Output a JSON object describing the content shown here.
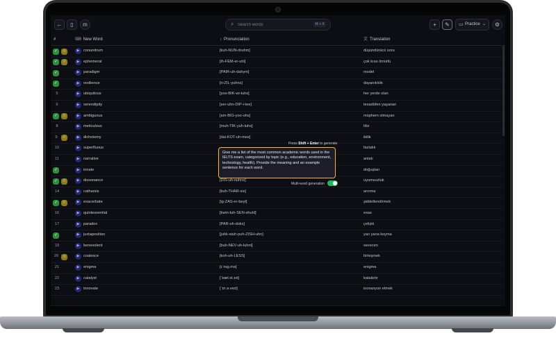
{
  "search": {
    "placeholder": "Search words",
    "shortcut": "⌘ + K"
  },
  "practice": {
    "label": "Practice"
  },
  "columns": {
    "num": "#",
    "word": "New Word",
    "pronunciation": "Pronunciation",
    "translation": "Translation"
  },
  "rows": [
    {
      "num": "",
      "green": true,
      "yellow": true,
      "word": "conundrum",
      "pron": "[kuh-NUN-druhm]",
      "trans": "düşündürücü soru"
    },
    {
      "num": "",
      "green": true,
      "yellow": true,
      "word": "ephemeral",
      "pron": "[ih-FEM-er-uhl]",
      "trans": "çok kısa ömürlü"
    },
    {
      "num": "",
      "green": true,
      "yellow": false,
      "word": "paradigm",
      "pron": "[PAIR-uh-dahym]",
      "trans": "model"
    },
    {
      "num": "",
      "green": true,
      "yellow": false,
      "word": "resilience",
      "pron": "[ri-ZIL-yuhns]",
      "trans": "dayanıklılık"
    },
    {
      "num": "5",
      "green": false,
      "yellow": false,
      "word": "ubiquitous",
      "pron": "[yoo-BIK-wi-tuhs]",
      "trans": "her yerde olan"
    },
    {
      "num": "6",
      "green": false,
      "yellow": false,
      "word": "serendipity",
      "pron": "[ser-uhn-DIP-i-tee]",
      "trans": "tesadüfen yaşanan"
    },
    {
      "num": "",
      "green": true,
      "yellow": true,
      "word": "ambiguous",
      "pron": "[am-BIG-yoo-uhs]",
      "trans": "müphem olmayan"
    },
    {
      "num": "8",
      "green": false,
      "yellow": false,
      "word": "meticulous",
      "pron": "[muh-TIK-yuh-luhs]",
      "trans": "titiz"
    },
    {
      "num": "9",
      "green": false,
      "yellow": true,
      "word": "dichotomy",
      "pron": "[dai-KOT-uh-mee]",
      "trans": "ikilik"
    },
    {
      "num": "10",
      "green": false,
      "yellow": false,
      "word": "superfluous",
      "pron": "",
      "trans": "fazlalık"
    },
    {
      "num": "11",
      "green": false,
      "yellow": false,
      "word": "narrative",
      "pron": "",
      "trans": "anlatı"
    },
    {
      "num": "",
      "green": true,
      "yellow": false,
      "word": "innate",
      "pron": "",
      "trans": "doğuştan"
    },
    {
      "num": "",
      "green": true,
      "yellow": true,
      "word": "dissonance",
      "pron": "[DIS-uh-nuhns]",
      "trans": "uyumsuzluk"
    },
    {
      "num": "14",
      "green": false,
      "yellow": false,
      "word": "catharsis",
      "pron": "[kuh-THAR-sis]",
      "trans": "arınma"
    },
    {
      "num": "",
      "green": true,
      "yellow": true,
      "word": "exacerbate",
      "pron": "[ig-ZAS-er-beyt]",
      "trans": "şiddetlendirmek"
    },
    {
      "num": "16",
      "green": false,
      "yellow": false,
      "word": "quintessential",
      "pron": "[kwin-tuh-SEN-shuhl]",
      "trans": "esas"
    },
    {
      "num": "17",
      "green": false,
      "yellow": false,
      "word": "paradox",
      "pron": "[PAR-uh-doks]",
      "trans": "çelişki"
    },
    {
      "num": "",
      "green": true,
      "yellow": false,
      "word": "juxtaposition",
      "pron": "[juhk-stuh-puh-ZISH-uhn]",
      "trans": "yan yana koyma"
    },
    {
      "num": "19",
      "green": false,
      "yellow": false,
      "word": "benevolent",
      "pron": "[buh-NEV-uh-luhnt]",
      "trans": "sevecen"
    },
    {
      "num": "20",
      "green": false,
      "yellow": true,
      "word": "coalesce",
      "pron": "[koh-uh-LESS]",
      "trans": "birleşmek"
    },
    {
      "num": "21",
      "green": false,
      "yellow": false,
      "word": "enigma",
      "pron": "[ɪˈnɪɡ.mə]",
      "trans": "enigma"
    },
    {
      "num": "22",
      "green": false,
      "yellow": false,
      "word": "catalyst",
      "pron": "[ˈkæt.əl.ɪst]",
      "trans": "katalizör"
    },
    {
      "num": "23",
      "green": false,
      "yellow": false,
      "word": "innovate",
      "pron": "[ˈɪn.ə.veɪt]",
      "trans": "inovasyon etmek"
    },
    {
      "num": "",
      "green": false,
      "yellow": false,
      "word": "",
      "pron": "",
      "trans": ""
    }
  ],
  "prompt": {
    "hint_prefix": "Press",
    "hint_key": "Shift + Enter",
    "hint_suffix": "to generate",
    "text": "Give me a list of the most common academic words used in the IELTS exam, categorized by topic (e.g., education, environment, technology, health). Provide the meaning and an example sentence for each word.",
    "multi_label": "Multi-word generation",
    "multi_enabled": true
  },
  "colors": {
    "accent_green": "#2f8f3e",
    "accent_yellow": "#8c7a1f",
    "prompt_border": "#e2b96a",
    "toggle_on": "#29b35a"
  }
}
